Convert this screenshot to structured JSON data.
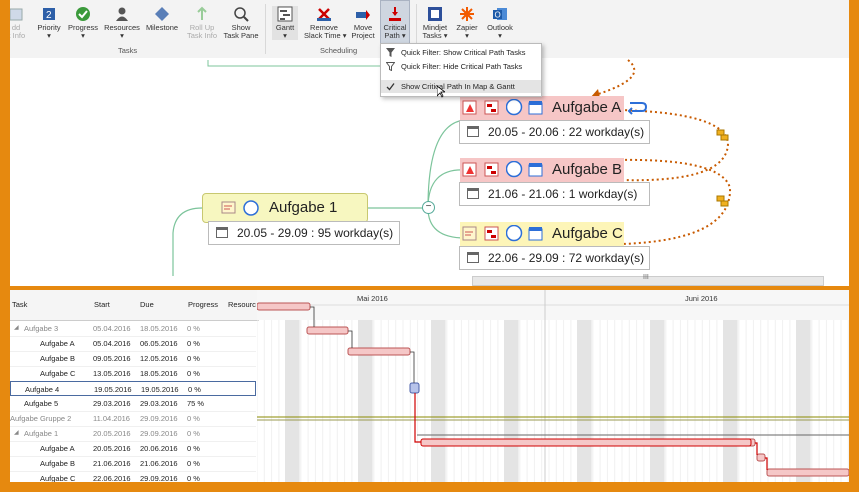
{
  "ribbon": {
    "buttons": [
      {
        "name": "add-task-info-button",
        "label": "dd\nk Info",
        "disabled": true
      },
      {
        "name": "priority-button",
        "label": "Priority\n▾"
      },
      {
        "name": "progress-button",
        "label": "Progress\n▾"
      },
      {
        "name": "resources-button",
        "label": "Resources\n▾"
      },
      {
        "name": "milestone-button",
        "label": "Milestone"
      },
      {
        "name": "roll-up-task-info-button",
        "label": "Roll Up\nTask Info",
        "disabled": true
      },
      {
        "name": "show-task-pane-button",
        "label": "Show\nTask Pane"
      },
      {
        "name": "gantt-button",
        "label": "Gantt\n▾"
      },
      {
        "name": "remove-slack-time-button",
        "label": "Remove\nSlack Time ▾"
      },
      {
        "name": "move-project-button",
        "label": "Move\nProject"
      },
      {
        "name": "critical-path-button",
        "label": "Critical\nPath ▾"
      },
      {
        "name": "mindjet-tasks-button",
        "label": "Mindjet\nTasks ▾"
      },
      {
        "name": "zapier-button",
        "label": "Zapier\n▾"
      },
      {
        "name": "outlook-button",
        "label": "Outlook\n▾"
      }
    ],
    "groups": {
      "tasks": "Tasks",
      "scheduling": "Scheduling"
    }
  },
  "critical_path_menu": {
    "items": [
      {
        "label": "Quick Filter: Show Critical Path Tasks"
      },
      {
        "label": "Quick Filter: Hide Critical Path Tasks"
      },
      {
        "label": "Show Critical Path In Map & Gantt",
        "checked": true
      }
    ]
  },
  "map": {
    "parent": {
      "label": "Aufgabe 1",
      "dates": "20.05 - 29.09 : 95 workday(s)"
    },
    "children": [
      {
        "label": "Aufgabe A",
        "dates": "20.05 - 20.06 : 22 workday(s)",
        "critical": true
      },
      {
        "label": "Aufgabe B",
        "dates": "21.06 - 21.06 : 1 workday(s)",
        "critical": true
      },
      {
        "label": "Aufgabe C",
        "dates": "22.06 - 29.09 : 72 workday(s)",
        "critical": false
      }
    ],
    "collapse_glyph": "−",
    "scroll_grip": "III",
    "colors": {
      "critical": "#f6c6c6",
      "normal": "#fdf5b8",
      "parent": "#f7f7c0",
      "link": "#c85a00"
    }
  },
  "gantt": {
    "columns": [
      "Task",
      "Start",
      "Due",
      "Progress",
      "Resourc"
    ],
    "months": [
      "Mai 2016",
      "Juni 2016"
    ],
    "rows": [
      {
        "indent": 0,
        "toggle": "◢",
        "task": "Aufgabe 3",
        "start": "05.04.2016",
        "due": "18.05.2016",
        "progress": "0 %",
        "grey": true
      },
      {
        "indent": 1,
        "task": "Aufgabe A",
        "start": "05.04.2016",
        "due": "06.05.2016",
        "progress": "0 %"
      },
      {
        "indent": 1,
        "task": "Aufgabe B",
        "start": "09.05.2016",
        "due": "12.05.2016",
        "progress": "0 %"
      },
      {
        "indent": 1,
        "task": "Aufgabe C",
        "start": "13.05.2016",
        "due": "18.05.2016",
        "progress": "0 %"
      },
      {
        "indent": 0,
        "task": "Aufgabe 4",
        "start": "19.05.2016",
        "due": "19.05.2016",
        "progress": "0 %",
        "selected": true
      },
      {
        "indent": 0,
        "task": "Aufgabe 5",
        "start": "29.03.2016",
        "due": "29.03.2016",
        "progress": "75 %"
      },
      {
        "indent": -1,
        "task": "Aufgabe Gruppe 2",
        "start": "11.04.2016",
        "due": "29.09.2016",
        "progress": "0 %",
        "grey": true
      },
      {
        "indent": 0,
        "toggle": "◢",
        "task": "Aufgabe 1",
        "start": "20.05.2016",
        "due": "29.09.2016",
        "progress": "0 %",
        "grey": true
      },
      {
        "indent": 1,
        "task": "Aufgabe A",
        "start": "20.05.2016",
        "due": "20.06.2016",
        "progress": "0 %"
      },
      {
        "indent": 1,
        "task": "Aufgabe B",
        "start": "21.06.2016",
        "due": "21.06.2016",
        "progress": "0 %"
      },
      {
        "indent": 1,
        "task": "Aufgabe C",
        "start": "22.06.2016",
        "due": "29.09.2016",
        "progress": "0 %"
      }
    ],
    "colors": {
      "bar": "#f5c7c7",
      "bar_border": "#b55",
      "critical_line": "#d00000",
      "weekend": "#e4e4e4",
      "summary_line": "#8a8a00"
    }
  }
}
